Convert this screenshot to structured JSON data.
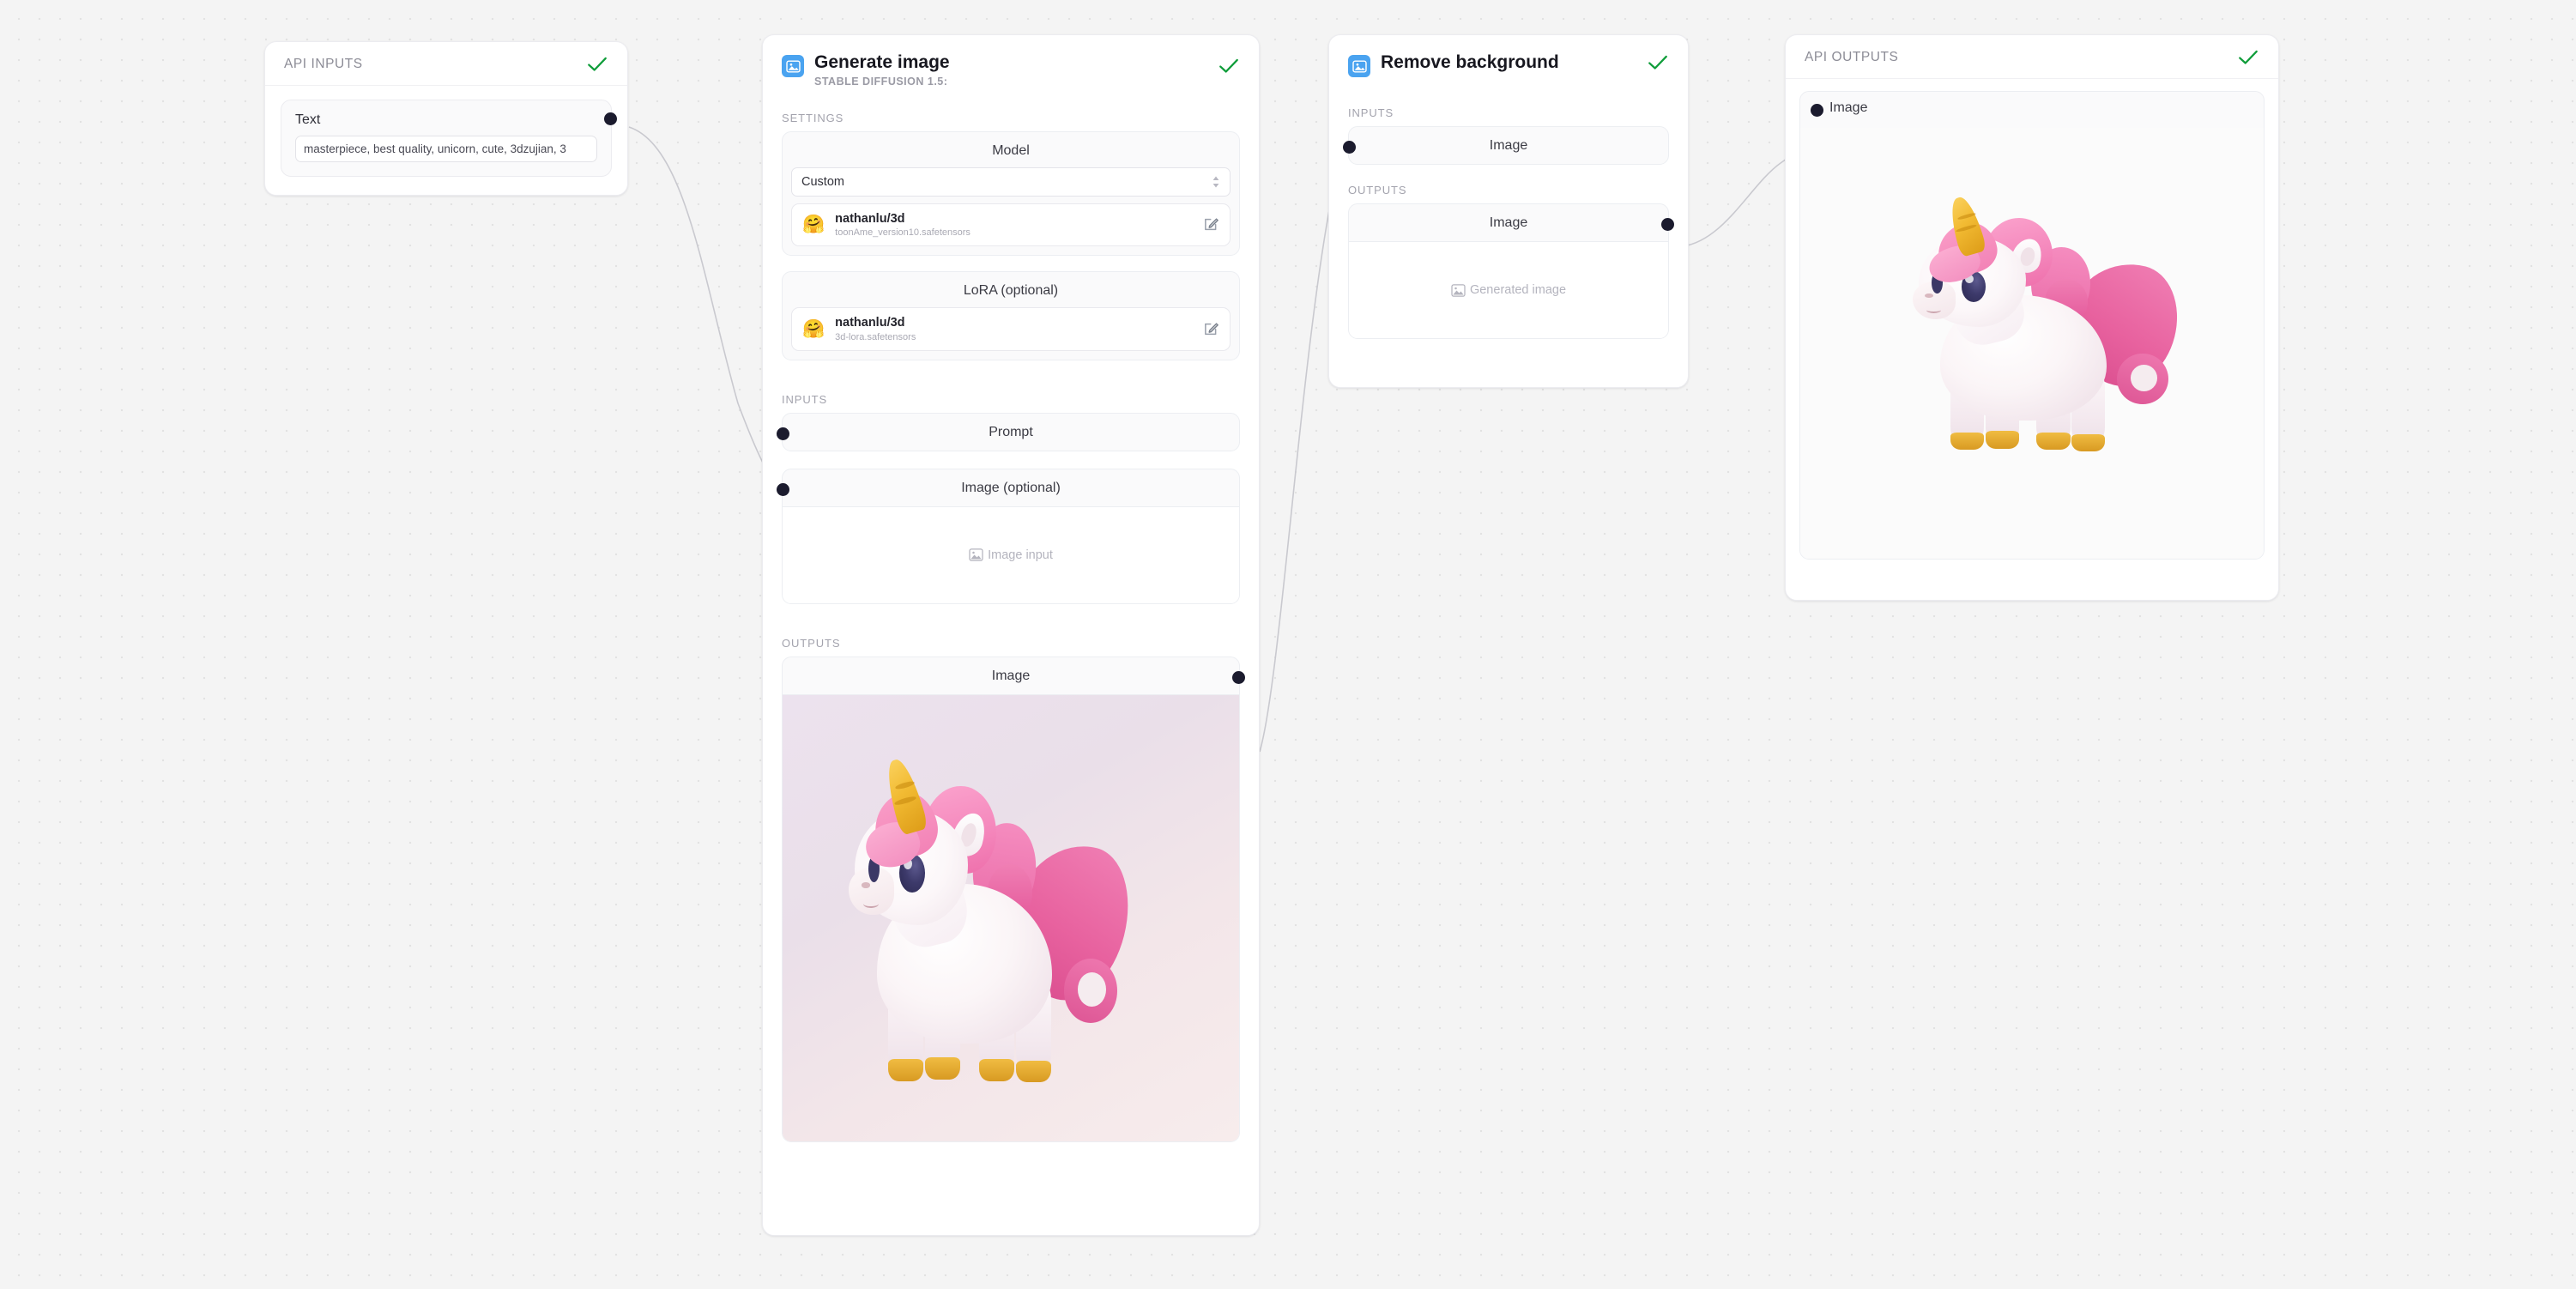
{
  "canvas": {
    "background_color": "#f4f4f4",
    "dot_color": "#e2e2e2",
    "edge_color": "#c9c9cf"
  },
  "status_check_color": "#0f9d3a",
  "accent_color": "#4aa3f0",
  "port_dot_color": "#1b1b2e",
  "api_inputs": {
    "title": "API INPUTS",
    "status_icon": "check-icon",
    "fields": [
      {
        "label": "Text",
        "value": "masterpiece, best quality, unicorn, cute, 3dzujian, 3",
        "placeholder": "Enter text",
        "port": "output"
      }
    ]
  },
  "generate_image_node": {
    "icon": "image-icon",
    "title": "Generate image",
    "subtitle": "STABLE DIFFUSION 1.5:",
    "status_icon": "check-icon",
    "settings_label": "SETTINGS",
    "model_group": {
      "title": "Model",
      "select_value": "Custom",
      "select_icon": "stepper-icon",
      "entry": {
        "avatar_icon": "huggingface-icon",
        "name": "nathanlu/3d",
        "file": "toonAme_version10.safetensors",
        "edit_icon": "edit-icon"
      }
    },
    "lora_group": {
      "title": "LoRA (optional)",
      "entry": {
        "avatar_icon": "huggingface-icon",
        "name": "nathanlu/3d",
        "file": "3d-lora.safetensors",
        "edit_icon": "edit-icon"
      }
    },
    "inputs_label": "INPUTS",
    "inputs": [
      {
        "label": "Prompt"
      },
      {
        "label": "Image (optional)",
        "placeholder": "Image input",
        "placeholder_icon": "image-placeholder-icon"
      }
    ],
    "outputs_label": "OUTPUTS",
    "outputs": [
      {
        "label": "Image",
        "preview": "unicorn-3d-render",
        "preview_background": "pink-gradient"
      }
    ]
  },
  "remove_background_node": {
    "icon": "image-icon",
    "title": "Remove background",
    "status_icon": "check-icon",
    "inputs_label": "INPUTS",
    "inputs": [
      {
        "label": "Image"
      }
    ],
    "outputs_label": "OUTPUTS",
    "outputs": [
      {
        "label": "Image",
        "placeholder": "Generated image",
        "placeholder_icon": "image-placeholder-icon"
      }
    ]
  },
  "api_outputs": {
    "title": "API OUTPUTS",
    "status_icon": "check-icon",
    "fields": [
      {
        "label": "Image",
        "port": "input",
        "preview": "unicorn-3d-render",
        "preview_background": "plain-white"
      }
    ]
  }
}
